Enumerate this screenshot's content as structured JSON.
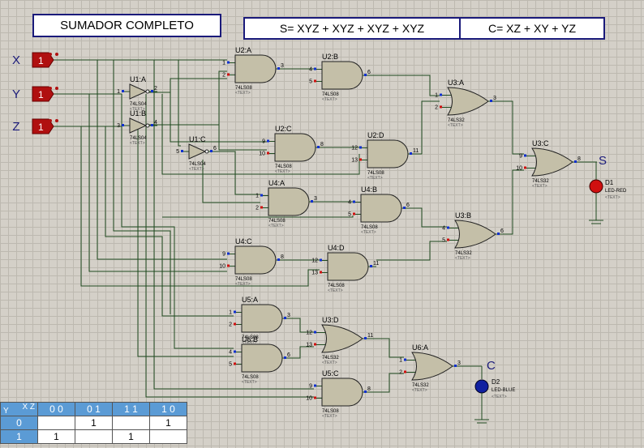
{
  "titles": {
    "main": "SUMADOR COMPLETO",
    "sum_eq": "S= XYZ + XYZ + XYZ + XYZ",
    "carry_eq": "C= XZ + XY + YZ"
  },
  "inputs": [
    {
      "name": "X",
      "state": "1"
    },
    {
      "name": "Y",
      "state": "1"
    },
    {
      "name": "Z",
      "state": "1"
    }
  ],
  "outputs": {
    "s_label": "S",
    "c_label": "C",
    "d1_name": "D1",
    "d1_type": "LED-RED",
    "d2_name": "D2",
    "d2_type": "LED-BLUE",
    "text_placeholder": "<TEXT>"
  },
  "chips": {
    "and": "74LS08",
    "or": "74LS32",
    "not": "74LS04"
  },
  "gates": [
    {
      "id": "U2:A",
      "type": "and",
      "pins": [
        "1",
        "2",
        "3"
      ]
    },
    {
      "id": "U2:B",
      "type": "and",
      "pins": [
        "4",
        "5",
        "6"
      ]
    },
    {
      "id": "U3:A",
      "type": "or",
      "pins": [
        "1",
        "2",
        "3"
      ]
    },
    {
      "id": "U2:C",
      "type": "and",
      "pins": [
        "9",
        "10",
        "8"
      ]
    },
    {
      "id": "U2:D",
      "type": "and",
      "pins": [
        "12",
        "13",
        "11"
      ]
    },
    {
      "id": "U3:C",
      "type": "or",
      "pins": [
        "9",
        "10",
        "8"
      ]
    },
    {
      "id": "U4:A",
      "type": "and",
      "pins": [
        "1",
        "2",
        "3"
      ]
    },
    {
      "id": "U4:B",
      "type": "and",
      "pins": [
        "4",
        "5",
        "6"
      ]
    },
    {
      "id": "U3:B",
      "type": "or",
      "pins": [
        "4",
        "5",
        "6"
      ]
    },
    {
      "id": "U4:C",
      "type": "and",
      "pins": [
        "9",
        "10",
        "8"
      ]
    },
    {
      "id": "U4:D",
      "type": "and",
      "pins": [
        "12",
        "13",
        "11"
      ]
    },
    {
      "id": "U5:A",
      "type": "and",
      "pins": [
        "1",
        "2",
        "3"
      ]
    },
    {
      "id": "U6:B",
      "type": "and",
      "pins": [
        "4",
        "5",
        "6"
      ]
    },
    {
      "id": "U3:D",
      "type": "or",
      "pins": [
        "12",
        "13",
        "11"
      ]
    },
    {
      "id": "U6:A",
      "type": "or",
      "pins": [
        "1",
        "2",
        "3"
      ]
    },
    {
      "id": "U5:C",
      "type": "and",
      "pins": [
        "9",
        "10",
        "8"
      ]
    },
    {
      "id": "U1:A",
      "type": "not",
      "pins": [
        "1",
        "2"
      ]
    },
    {
      "id": "U1:B",
      "type": "not",
      "pins": [
        "3",
        "4"
      ]
    },
    {
      "id": "U1:C",
      "type": "not",
      "pins": [
        "5",
        "6"
      ]
    }
  ],
  "truth_table": {
    "corner_top": "X Z",
    "corner_bottom": "Y",
    "columns": [
      "0 0",
      "0 1",
      "1 1",
      "1 0"
    ],
    "rows": [
      {
        "label": "0",
        "cells": [
          "",
          "1",
          "",
          "1"
        ]
      },
      {
        "label": "1",
        "cells": [
          "1",
          "",
          "1",
          ""
        ]
      }
    ]
  },
  "colors": {
    "wire": "#1f4a1f",
    "gate_fill": "#c4bfa8",
    "gate_stroke": "#202020",
    "input_box": "#b01010",
    "title_border": "#1a1a7a",
    "led_red": "#d01010",
    "led_blue": "#1020a0",
    "pin_red": "#d01010",
    "pin_blue": "#1030d0"
  }
}
